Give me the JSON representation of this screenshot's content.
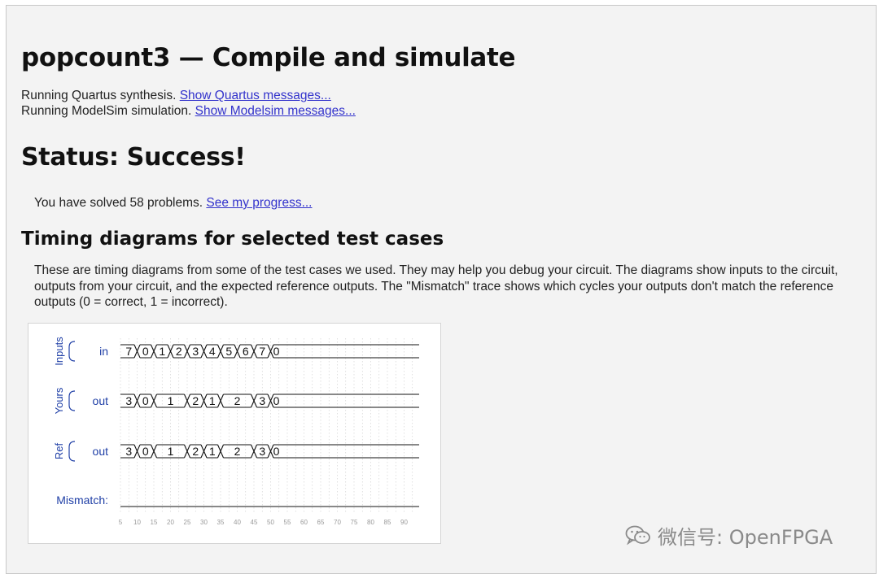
{
  "page": {
    "title": "popcount3 — Compile and simulate",
    "quartus_line": "Running Quartus synthesis.",
    "quartus_link": "Show Quartus messages...",
    "modelsim_line": "Running ModelSim simulation.",
    "modelsim_link": "Show Modelsim messages...",
    "status_heading": "Status: Success!",
    "solved_text": "You have solved 58 problems.",
    "progress_link": "See my progress...",
    "timing_heading": "Timing diagrams for selected test cases",
    "description": "These are timing diagrams from some of the test cases we used. They may help you debug your circuit. The diagrams show inputs to the circuit, outputs from your circuit, and the expected reference outputs. The \"Mismatch\" trace shows which cycles your outputs don't match the reference outputs (0 = correct, 1 = incorrect)."
  },
  "diagram": {
    "groups": [
      {
        "label": "Inputs",
        "signal": "in",
        "segments": [
          [
            "7",
            5
          ],
          [
            "0",
            10
          ],
          [
            "1",
            15
          ],
          [
            "2",
            20
          ],
          [
            "3",
            25
          ],
          [
            "4",
            30
          ],
          [
            "5",
            35
          ],
          [
            "6",
            40
          ],
          [
            "7",
            45
          ],
          [
            "0",
            50
          ]
        ]
      },
      {
        "label": "Yours",
        "signal": "out",
        "segments": [
          [
            "3",
            5
          ],
          [
            "0",
            10
          ],
          [
            "1",
            15
          ],
          [
            "2",
            25
          ],
          [
            "1",
            30
          ],
          [
            "2",
            35
          ],
          [
            "3",
            45
          ],
          [
            "0",
            50
          ]
        ]
      },
      {
        "label": "Ref",
        "signal": "out",
        "segments": [
          [
            "3",
            5
          ],
          [
            "0",
            10
          ],
          [
            "1",
            15
          ],
          [
            "2",
            25
          ],
          [
            "1",
            30
          ],
          [
            "2",
            35
          ],
          [
            "3",
            45
          ],
          [
            "0",
            50
          ]
        ]
      }
    ],
    "mismatch_label": "Mismatch:",
    "mismatch_value": 0,
    "time_ticks": [
      "5",
      "10",
      "15",
      "20",
      "25",
      "30",
      "35",
      "40",
      "45",
      "50",
      "55",
      "60",
      "65",
      "70",
      "75",
      "80",
      "85",
      "90"
    ],
    "colors": {
      "label_blue": "#1f3fa6",
      "trace": "#111111",
      "grid": "#cccccc"
    }
  },
  "watermark": {
    "icon": "wechat-icon",
    "text": "微信号: OpenFPGA"
  }
}
